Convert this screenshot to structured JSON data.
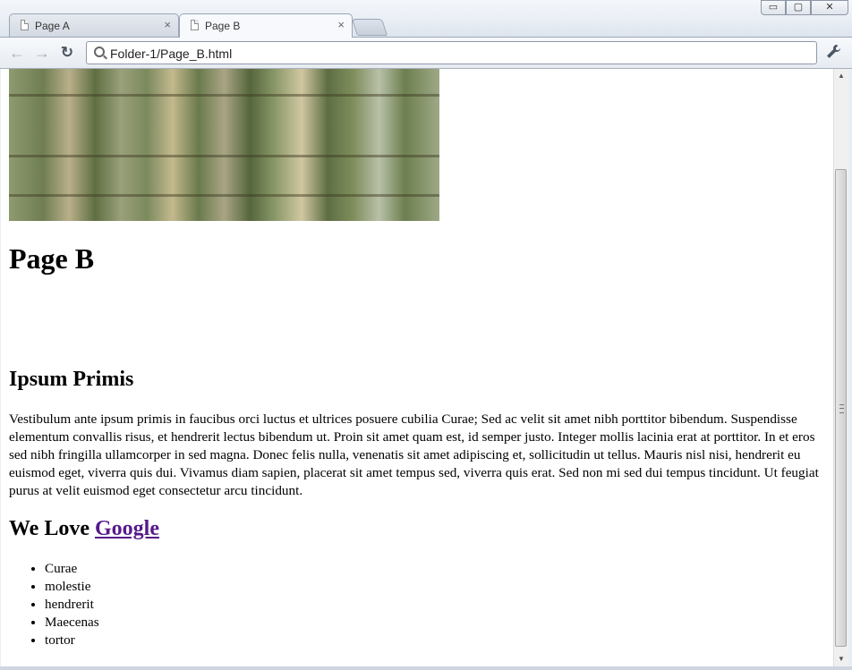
{
  "tabs": [
    {
      "label": "Page A",
      "close": "×",
      "active": false
    },
    {
      "label": "Page B",
      "close": "×",
      "active": true
    }
  ],
  "window_controls": {
    "minimize": "▭",
    "maximize": "▢",
    "close": "✕"
  },
  "toolbar": {
    "back_icon": "←",
    "forward_icon": "→",
    "reload_icon": "↻",
    "address": "Folder-1/Page_B.html",
    "wrench_icon": "🔧"
  },
  "page": {
    "title": "Page B",
    "section_heading": "Ipsum Primis",
    "paragraph": "Vestibulum ante ipsum primis in faucibus orci luctus et ultrices posuere cubilia Curae; Sed ac velit sit amet nibh porttitor bibendum. Suspendisse elementum convallis risus, et hendrerit lectus bibendum ut. Proin sit amet quam est, id semper justo. Integer mollis lacinia erat at porttitor. In et eros sed nibh fringilla ullamcorper in sed magna. Donec felis nulla, venenatis sit amet adipiscing et, sollicitudin ut tellus. Mauris nisl nisi, hendrerit eu euismod eget, viverra quis dui. Vivamus diam sapien, placerat sit amet tempus sed, viverra quis erat. Sed non mi sed dui tempus tincidunt. Ut feugiat purus at velit euismod eget consectetur arcu tincidunt.",
    "love_prefix": "We Love ",
    "love_link": "Google",
    "list_items": [
      "Curae",
      "molestie",
      "hendrerit",
      "Maecenas",
      "tortor"
    ]
  },
  "colors": {
    "visited_link": "#551a8b"
  }
}
